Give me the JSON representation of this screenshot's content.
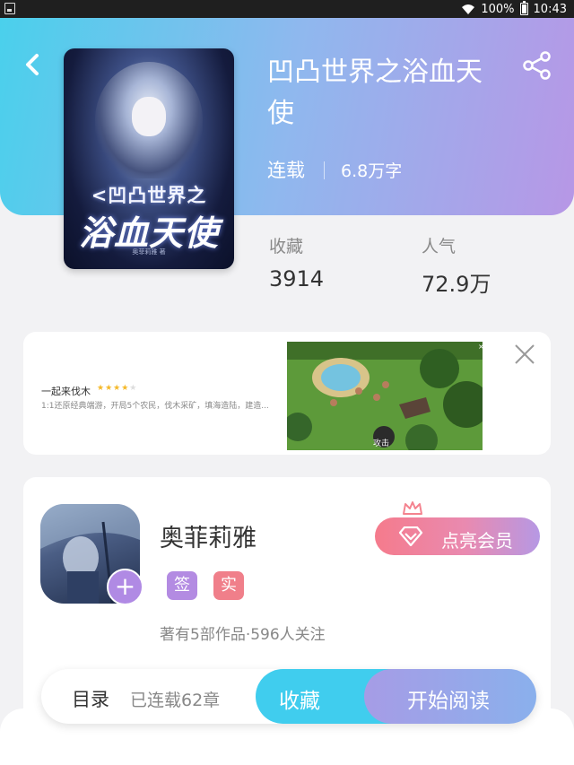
{
  "status_bar": {
    "battery": "100%",
    "time": "10:43"
  },
  "book": {
    "title": "凹凸世界之浴血天使",
    "status": "连载",
    "word_count": "6.8万字",
    "cover": {
      "line1": "<凹凸世界之",
      "line2": "浴血天使",
      "author": "奥菲莉雅 著"
    },
    "stats": [
      {
        "label": "收藏",
        "value": "3914"
      },
      {
        "label": "人气",
        "value": "72.9万"
      }
    ]
  },
  "ad": {
    "title": "一起来伐木",
    "rating": 4,
    "max_rating": 5,
    "description": "1:1还原经典端游，开局5个农民，伐木采矿，填海造陆，建造...",
    "image_button": "攻击"
  },
  "author": {
    "name": "奥菲莉雅",
    "badges": [
      {
        "label": "签",
        "color": "#b38be2"
      },
      {
        "label": "实",
        "color": "#f07f8a"
      }
    ],
    "meta": "著有5部作品·596人关注",
    "vip_button": "点亮会员"
  },
  "bottom_bar": {
    "toc_label": "目录",
    "chapter_count": "已连载62章",
    "collect_button": "收藏",
    "read_button": "开始阅读"
  },
  "colors": {
    "header_gradient": [
      "#4ad0ec",
      "#b797e6"
    ],
    "collect": "#40cdee",
    "vip": "#f57b8c"
  }
}
